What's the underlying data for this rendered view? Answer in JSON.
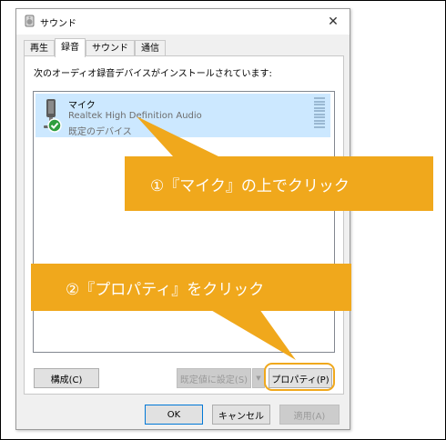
{
  "window": {
    "title": "サウンド",
    "close_glyph": "✕"
  },
  "tabs": [
    {
      "label": "再生",
      "active": false
    },
    {
      "label": "録音",
      "active": true
    },
    {
      "label": "サウンド",
      "active": false
    },
    {
      "label": "通信",
      "active": false
    }
  ],
  "panel": {
    "instruction": "次のオーディオ録音デバイスがインストールされています:",
    "devices": [
      {
        "name": "マイク",
        "driver": "Realtek High Definition Audio",
        "status": "既定のデバイス",
        "selected": true,
        "default_check": true
      }
    ],
    "buttons": {
      "configure": "構成(C)",
      "set_default": "既定値に設定(S)",
      "dropdown_glyph": "▼",
      "properties": "プロパティ(P)"
    }
  },
  "footer": {
    "ok": "OK",
    "cancel": "キャンセル",
    "apply": "適用(A)"
  },
  "annotations": {
    "callout1": "①『マイク』の上でクリック",
    "callout2": "②『プロパティ』をクリック",
    "color": "#f0a81c"
  },
  "colors": {
    "selection": "#cce8ff",
    "check_green": "#2e9e3e",
    "accent_blue": "#0078d7"
  }
}
